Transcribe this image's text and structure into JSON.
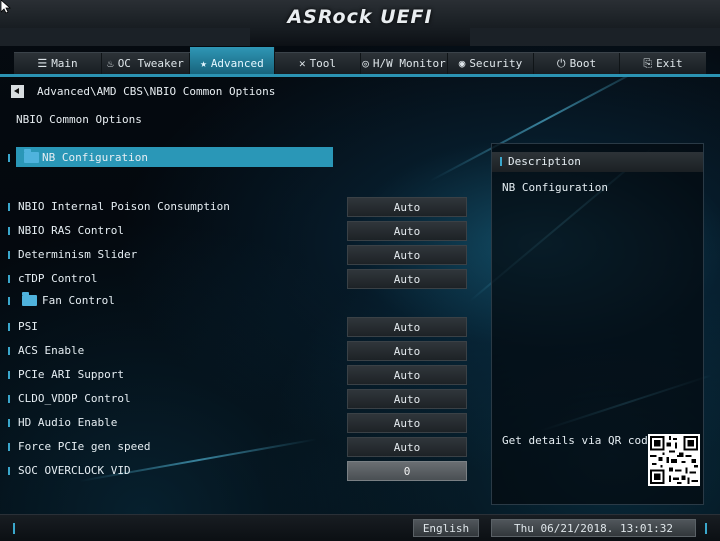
{
  "brand": {
    "logo": "ASRock UEFI"
  },
  "tabs": [
    {
      "label": "Main",
      "icon": "list-icon"
    },
    {
      "label": "OC Tweaker",
      "icon": "flame-icon"
    },
    {
      "label": "Advanced",
      "icon": "star-icon",
      "active": true
    },
    {
      "label": "Tool",
      "icon": "tools-icon"
    },
    {
      "label": "H/W Monitor",
      "icon": "monitor-icon"
    },
    {
      "label": "Security",
      "icon": "shield-icon"
    },
    {
      "label": "Boot",
      "icon": "power-icon"
    },
    {
      "label": "Exit",
      "icon": "exit-icon"
    }
  ],
  "breadcrumb": "Advanced\\AMD CBS\\NBIO Common Options",
  "page_title": "NBIO Common Options",
  "items": [
    {
      "label": "NB Configuration",
      "type": "submenu",
      "selected": true
    },
    {
      "label": "NBIO Internal Poison Consumption",
      "value": "Auto"
    },
    {
      "label": "NBIO RAS Control",
      "value": "Auto"
    },
    {
      "label": "Determinism Slider",
      "value": "Auto"
    },
    {
      "label": "cTDP Control",
      "value": "Auto"
    },
    {
      "label": "Fan Control",
      "type": "submenu"
    },
    {
      "label": "PSI",
      "value": "Auto"
    },
    {
      "label": "ACS Enable",
      "value": "Auto"
    },
    {
      "label": "PCIe ARI Support",
      "value": "Auto"
    },
    {
      "label": "CLDO_VDDP Control",
      "value": "Auto"
    },
    {
      "label": "HD Audio Enable",
      "value": "Auto"
    },
    {
      "label": "Force PCIe gen speed",
      "value": "Auto"
    },
    {
      "label": "SOC OVERCLOCK VID",
      "value": "0"
    }
  ],
  "description": {
    "header": "Description",
    "text": "NB Configuration",
    "qr_text": "Get details via QR code"
  },
  "footer": {
    "language": "English",
    "datetime": "Thu 06/21/2018. 13:01:32"
  },
  "colors": {
    "accent": "#2a97b7",
    "folder": "#4fb3dd"
  }
}
